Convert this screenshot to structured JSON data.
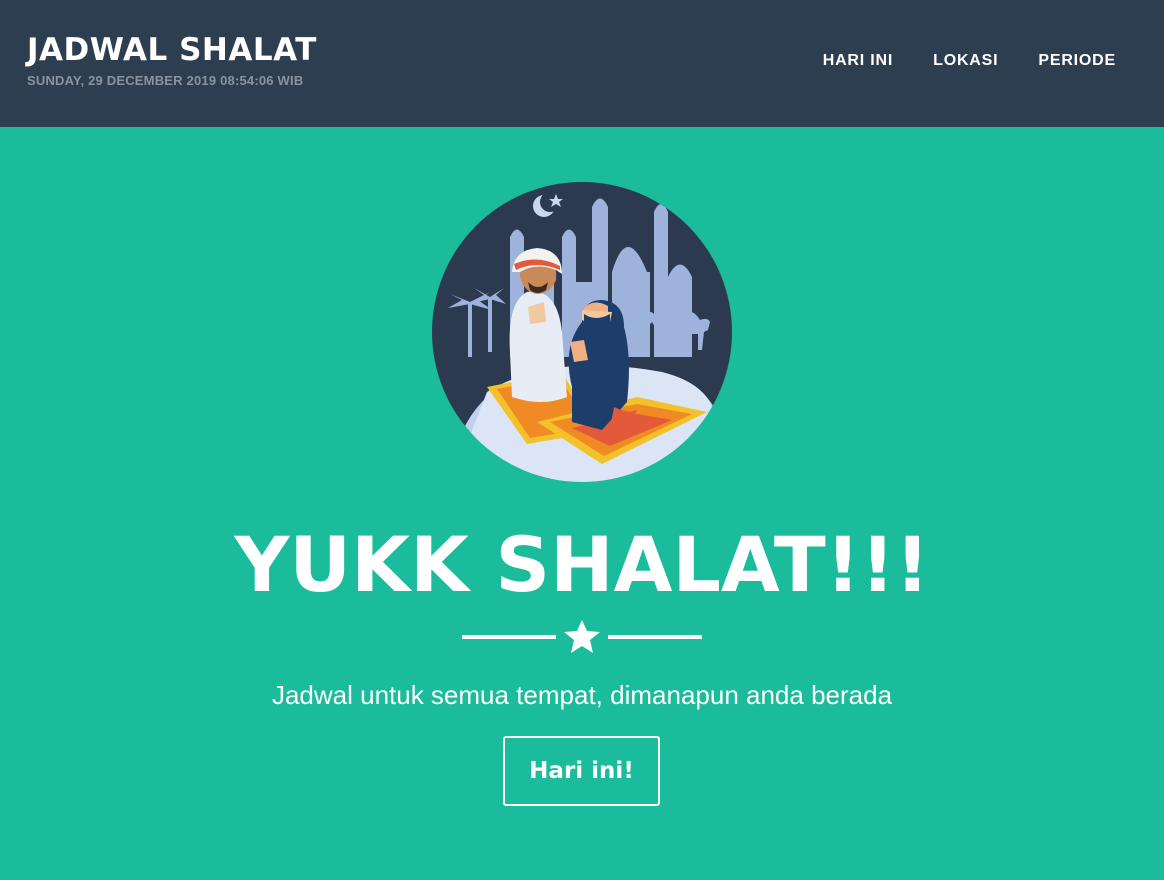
{
  "navbar": {
    "brand_title": "JADWAL SHALAT",
    "datetime": "SUNDAY, 29 DECEMBER 2019 08:54:06 WIB",
    "links": [
      {
        "label": "HARI INI"
      },
      {
        "label": "LOKASI"
      },
      {
        "label": "PERIODE"
      }
    ]
  },
  "hero": {
    "heading": "YUKK SHALAT!!!",
    "subtitle": "Jadwal untuk semua tempat, dimanapun anda berada",
    "cta_label": "Hari ini!",
    "divider_icon": "star-icon",
    "illustration": "praying-couple-mosque-illustration"
  },
  "colors": {
    "navbar_bg": "#2c3e50",
    "hero_bg": "#1abc9c",
    "text": "#ffffff",
    "subtext": "#8a94a0"
  }
}
